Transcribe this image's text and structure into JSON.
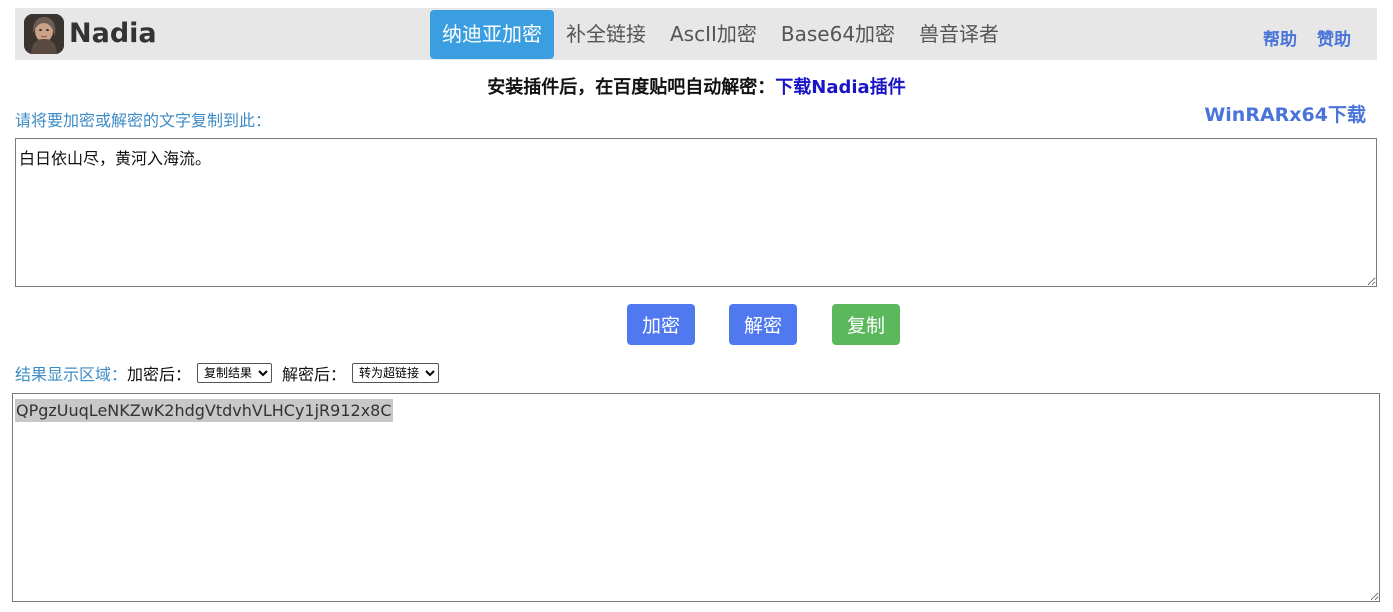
{
  "header": {
    "logo_text": "Nadia",
    "nav": [
      {
        "label": "纳迪亚加密",
        "active": true
      },
      {
        "label": "补全链接",
        "active": false
      },
      {
        "label": "AscII加密",
        "active": false
      },
      {
        "label": "Base64加密",
        "active": false
      },
      {
        "label": "兽音译者",
        "active": false
      }
    ],
    "help_label": "帮助",
    "donate_label": "赞助"
  },
  "notice": {
    "text": "安装插件后，在百度贴吧自动解密：",
    "link": "下载Nadia插件"
  },
  "input": {
    "label": "请将要加密或解密的文字复制到此：",
    "value": "白日依山尽，黄河入海流。",
    "side_link": "WinRARx64下载"
  },
  "buttons": {
    "encrypt": "加密",
    "decrypt": "解密",
    "copy": "复制"
  },
  "result": {
    "label": "结果显示区域：",
    "after_encrypt_label": "加密后：",
    "after_encrypt_selected": "复制结果",
    "after_decrypt_label": "解密后：",
    "after_decrypt_selected": "转为超链接",
    "value": "QPgzUuqLeNKZwK2hdgVtdvhVLHCy1jR912x8C"
  },
  "colors": {
    "nav_active": "#3b9ee0",
    "link_blue": "#4a74d9",
    "button_blue": "#5179ef",
    "button_green": "#5cb85c",
    "label_blue": "#3d8bc4"
  }
}
